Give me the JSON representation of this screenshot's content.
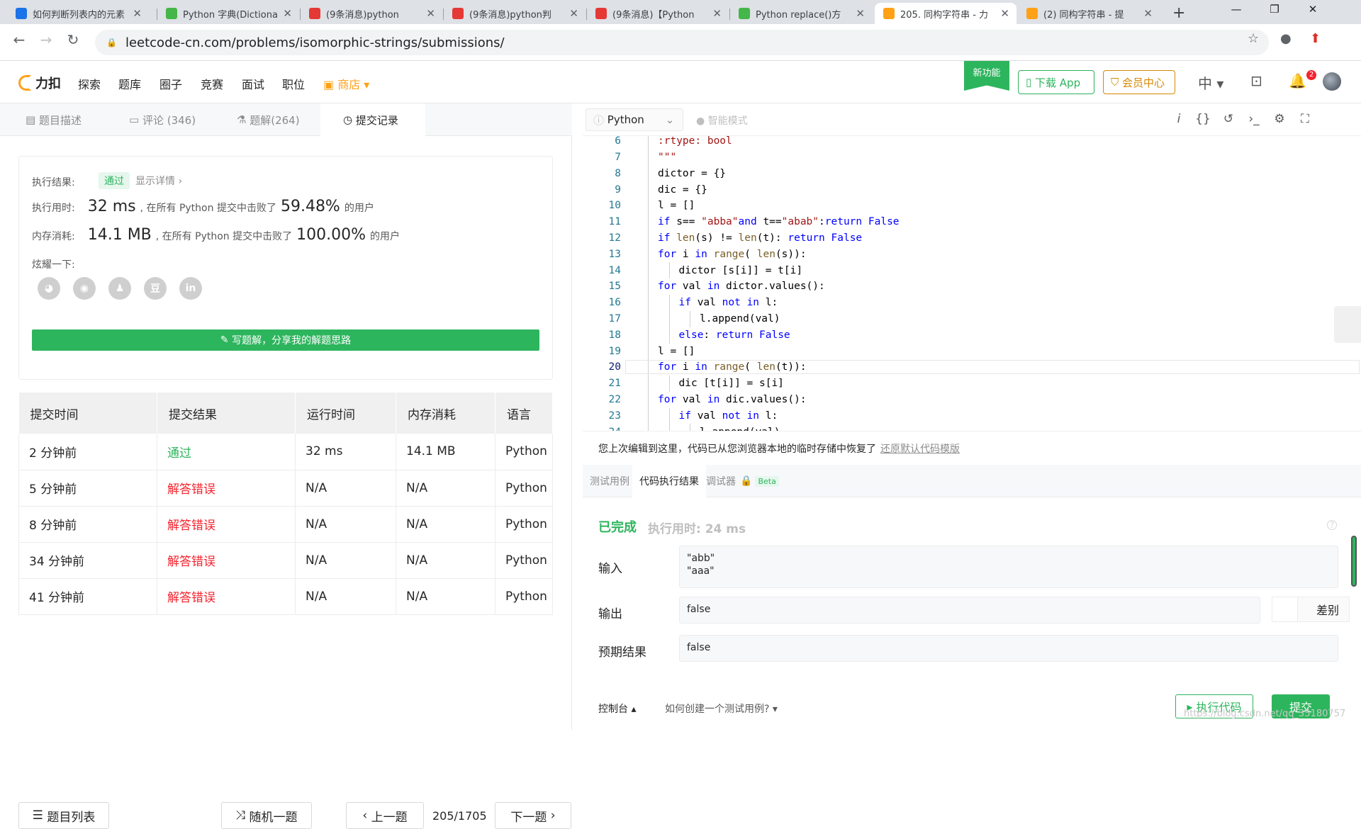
{
  "browser": {
    "tabs": [
      {
        "title": "如何判断列表内的元素",
        "favicon_color": "#1a73e8"
      },
      {
        "title": "Python 字典(Dictionary)",
        "favicon_color": "#45b649"
      },
      {
        "title": "(9条消息)python",
        "favicon_color": "#e53935"
      },
      {
        "title": "(9条消息)python判",
        "favicon_color": "#e53935"
      },
      {
        "title": "(9条消息)【Python",
        "favicon_color": "#e53935"
      },
      {
        "title": "Python replace()方",
        "favicon_color": "#45b649"
      },
      {
        "title": "205. 同构字符串 - 力",
        "favicon_color": "#ffa116"
      },
      {
        "title": "(2) 同构字符串 - 提",
        "favicon_color": "#ffa116"
      }
    ],
    "active_tab": 6,
    "url": "leetcode-cn.com/problems/isomorphic-strings/submissions/"
  },
  "header": {
    "logo_text": "力扣",
    "nav": [
      "探索",
      "题库",
      "圈子",
      "竞赛",
      "面试",
      "职位"
    ],
    "shop": "商店",
    "new_feature": "新功能",
    "download_app": "下载 App",
    "vip_center": "会员中心",
    "lang": "中",
    "notification_count": "2"
  },
  "left_tabs": [
    {
      "label": "题目描述",
      "icon": "doc-icon"
    },
    {
      "label": "评论 (346)",
      "icon": "comment-icon"
    },
    {
      "label": "题解(264)",
      "icon": "flask-icon"
    },
    {
      "label": "提交记录",
      "icon": "clock-icon"
    }
  ],
  "result": {
    "result_label": "执行结果:",
    "result_value": "通过",
    "show_detail": "显示详情 ›",
    "time_label": "执行用时:",
    "time_value": "32 ms",
    "time_mid": ", 在所有 Python 提交中击败了",
    "time_pct": "59.48%",
    "suffix": "的用户",
    "mem_label": "内存消耗:",
    "mem_value": "14.1 MB",
    "mem_mid": ", 在所有 Python 提交中击败了",
    "mem_pct": "100.00%",
    "share_label": "炫耀一下:",
    "social": [
      "wechat-icon",
      "weibo-icon",
      "qq-icon",
      "douban-icon",
      "linkedin-icon"
    ],
    "write_btn": "写题解，分享我的解题思路"
  },
  "submissions": {
    "headers": [
      "提交时间",
      "提交结果",
      "运行时间",
      "内存消耗",
      "语言"
    ],
    "rows": [
      {
        "time": "2 分钟前",
        "result": "通过",
        "ok": true,
        "runtime": "32 ms",
        "memory": "14.1 MB",
        "lang": "Python"
      },
      {
        "time": "5 分钟前",
        "result": "解答错误",
        "ok": false,
        "runtime": "N/A",
        "memory": "N/A",
        "lang": "Python"
      },
      {
        "time": "8 分钟前",
        "result": "解答错误",
        "ok": false,
        "runtime": "N/A",
        "memory": "N/A",
        "lang": "Python"
      },
      {
        "time": "34 分钟前",
        "result": "解答错误",
        "ok": false,
        "runtime": "N/A",
        "memory": "N/A",
        "lang": "Python"
      },
      {
        "time": "41 分钟前",
        "result": "解答错误",
        "ok": false,
        "runtime": "N/A",
        "memory": "N/A",
        "lang": "Python"
      }
    ]
  },
  "bottom_left": {
    "problem_list": "题目列表",
    "random": "随机一题",
    "prev": "上一题",
    "page": "205/1705",
    "next": "下一题"
  },
  "editor": {
    "language": "Python",
    "smart_mode": "智能模式",
    "current_line": 20,
    "lines": [
      {
        "n": 6,
        "indent": 2,
        "code": ":rtype: bool",
        "cls": "str"
      },
      {
        "n": 7,
        "indent": 2,
        "code": "\"\"\"",
        "cls": "str"
      },
      {
        "n": 8,
        "indent": 2,
        "code": "dictor = {}",
        "cls": ""
      },
      {
        "n": 9,
        "indent": 2,
        "code": "dic = {}",
        "cls": ""
      },
      {
        "n": 10,
        "indent": 2,
        "code": "l = []",
        "cls": ""
      },
      {
        "n": 11,
        "indent": 2,
        "code": "if s== \"abba\"and t==\"abab\":return False",
        "cls": ""
      },
      {
        "n": 12,
        "indent": 2,
        "code": "if len(s) != len(t): return False",
        "cls": ""
      },
      {
        "n": 13,
        "indent": 2,
        "code": "for i in range( len(s)):",
        "cls": ""
      },
      {
        "n": 14,
        "indent": 3,
        "code": "dictor [s[i]] = t[i]",
        "cls": ""
      },
      {
        "n": 15,
        "indent": 2,
        "code": "for val in dictor.values():",
        "cls": ""
      },
      {
        "n": 16,
        "indent": 3,
        "code": "if val not in l:",
        "cls": ""
      },
      {
        "n": 17,
        "indent": 4,
        "code": "l.append(val)",
        "cls": ""
      },
      {
        "n": 18,
        "indent": 3,
        "code": "else: return False",
        "cls": ""
      },
      {
        "n": 19,
        "indent": 2,
        "code": "l = []",
        "cls": ""
      },
      {
        "n": 20,
        "indent": 2,
        "code": "for i in range( len(t)):",
        "cls": ""
      },
      {
        "n": 21,
        "indent": 3,
        "code": "dic [t[i]] = s[i]",
        "cls": ""
      },
      {
        "n": 22,
        "indent": 2,
        "code": "for val in dic.values():",
        "cls": ""
      },
      {
        "n": 23,
        "indent": 3,
        "code": "if val not in l:",
        "cls": ""
      },
      {
        "n": 24,
        "indent": 4,
        "code": "l.append(val)",
        "cls": ""
      }
    ],
    "restore_msg": "您上次编辑到这里，代码已从您浏览器本地的临时存储中恢复了",
    "restore_link": "还原默认代码模版"
  },
  "run_panel": {
    "tabs": [
      "测试用例",
      "代码执行结果",
      "调试器"
    ],
    "beta": "Beta",
    "status": "已完成",
    "exec_time": "执行用时: 24 ms",
    "input_label": "输入",
    "input_lines": [
      "\"abb\"",
      "\"aaa\""
    ],
    "output_label": "输出",
    "output": "false",
    "diff": "差别",
    "expected_label": "预期结果",
    "expected": "false"
  },
  "bottom_right": {
    "console": "控制台 ▴",
    "howto": "如何创建一个测试用例? ▾",
    "run": "执行代码",
    "submit": "提交"
  },
  "watermark": "https://blog.csdn.net/qq_35180757"
}
